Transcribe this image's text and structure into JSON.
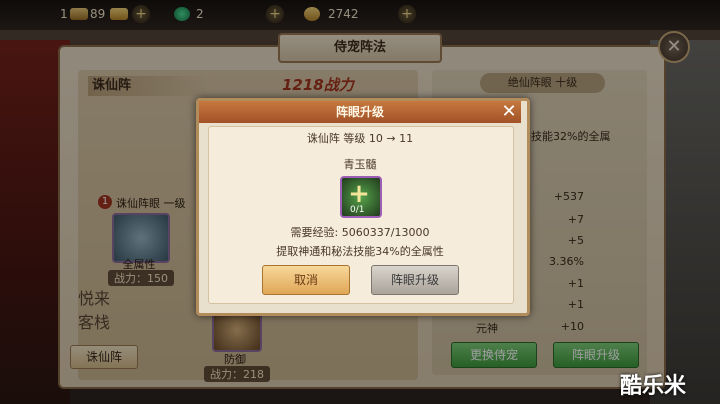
{
  "topbar": {
    "level": "1",
    "gold": "89",
    "jade": "2",
    "coins": "2742"
  },
  "panel": {
    "title": "侍宠阵法",
    "formation_name": "诛仙阵",
    "power": "1218战力",
    "formation_eye_label": "诛仙阵眼 一级",
    "eye_number": "1",
    "pets": [
      {
        "label": "全属性",
        "power": "战力：150"
      },
      {
        "label": "防御",
        "power": "战力：218"
      }
    ],
    "tab_button": "诛仙阵",
    "calligraphy": "悦来客栈"
  },
  "right": {
    "title": "绝仙阵眼 十级",
    "desc": "法技能32%的全属",
    "stats": [
      {
        "label": "",
        "value": "+537"
      },
      {
        "label": "",
        "value": "+7"
      },
      {
        "label": "",
        "value": "+5"
      },
      {
        "label": "",
        "value": "3.36%"
      },
      {
        "label": "",
        "value": "+1"
      },
      {
        "label": "",
        "value": "+1"
      },
      {
        "label": "元神",
        "value": "+10"
      }
    ],
    "swap_button": "更换侍宠",
    "upgrade_button": "阵眼升级"
  },
  "modal": {
    "title": "阵眼升级",
    "level_line": "诛仙阵 等级 10 → 11",
    "item_name": "青玉髓",
    "item_count": "0/1",
    "exp_line": "需要经验:    5060337/13000",
    "effect_line": "提取神通和秘法技能34%的全属性",
    "cancel": "取消",
    "confirm": "阵眼升级"
  },
  "watermark": "酷乐米",
  "colors": {
    "modal_header": "#b4602f",
    "green_button": "#4fae4c",
    "accent_red": "#a4341e"
  }
}
